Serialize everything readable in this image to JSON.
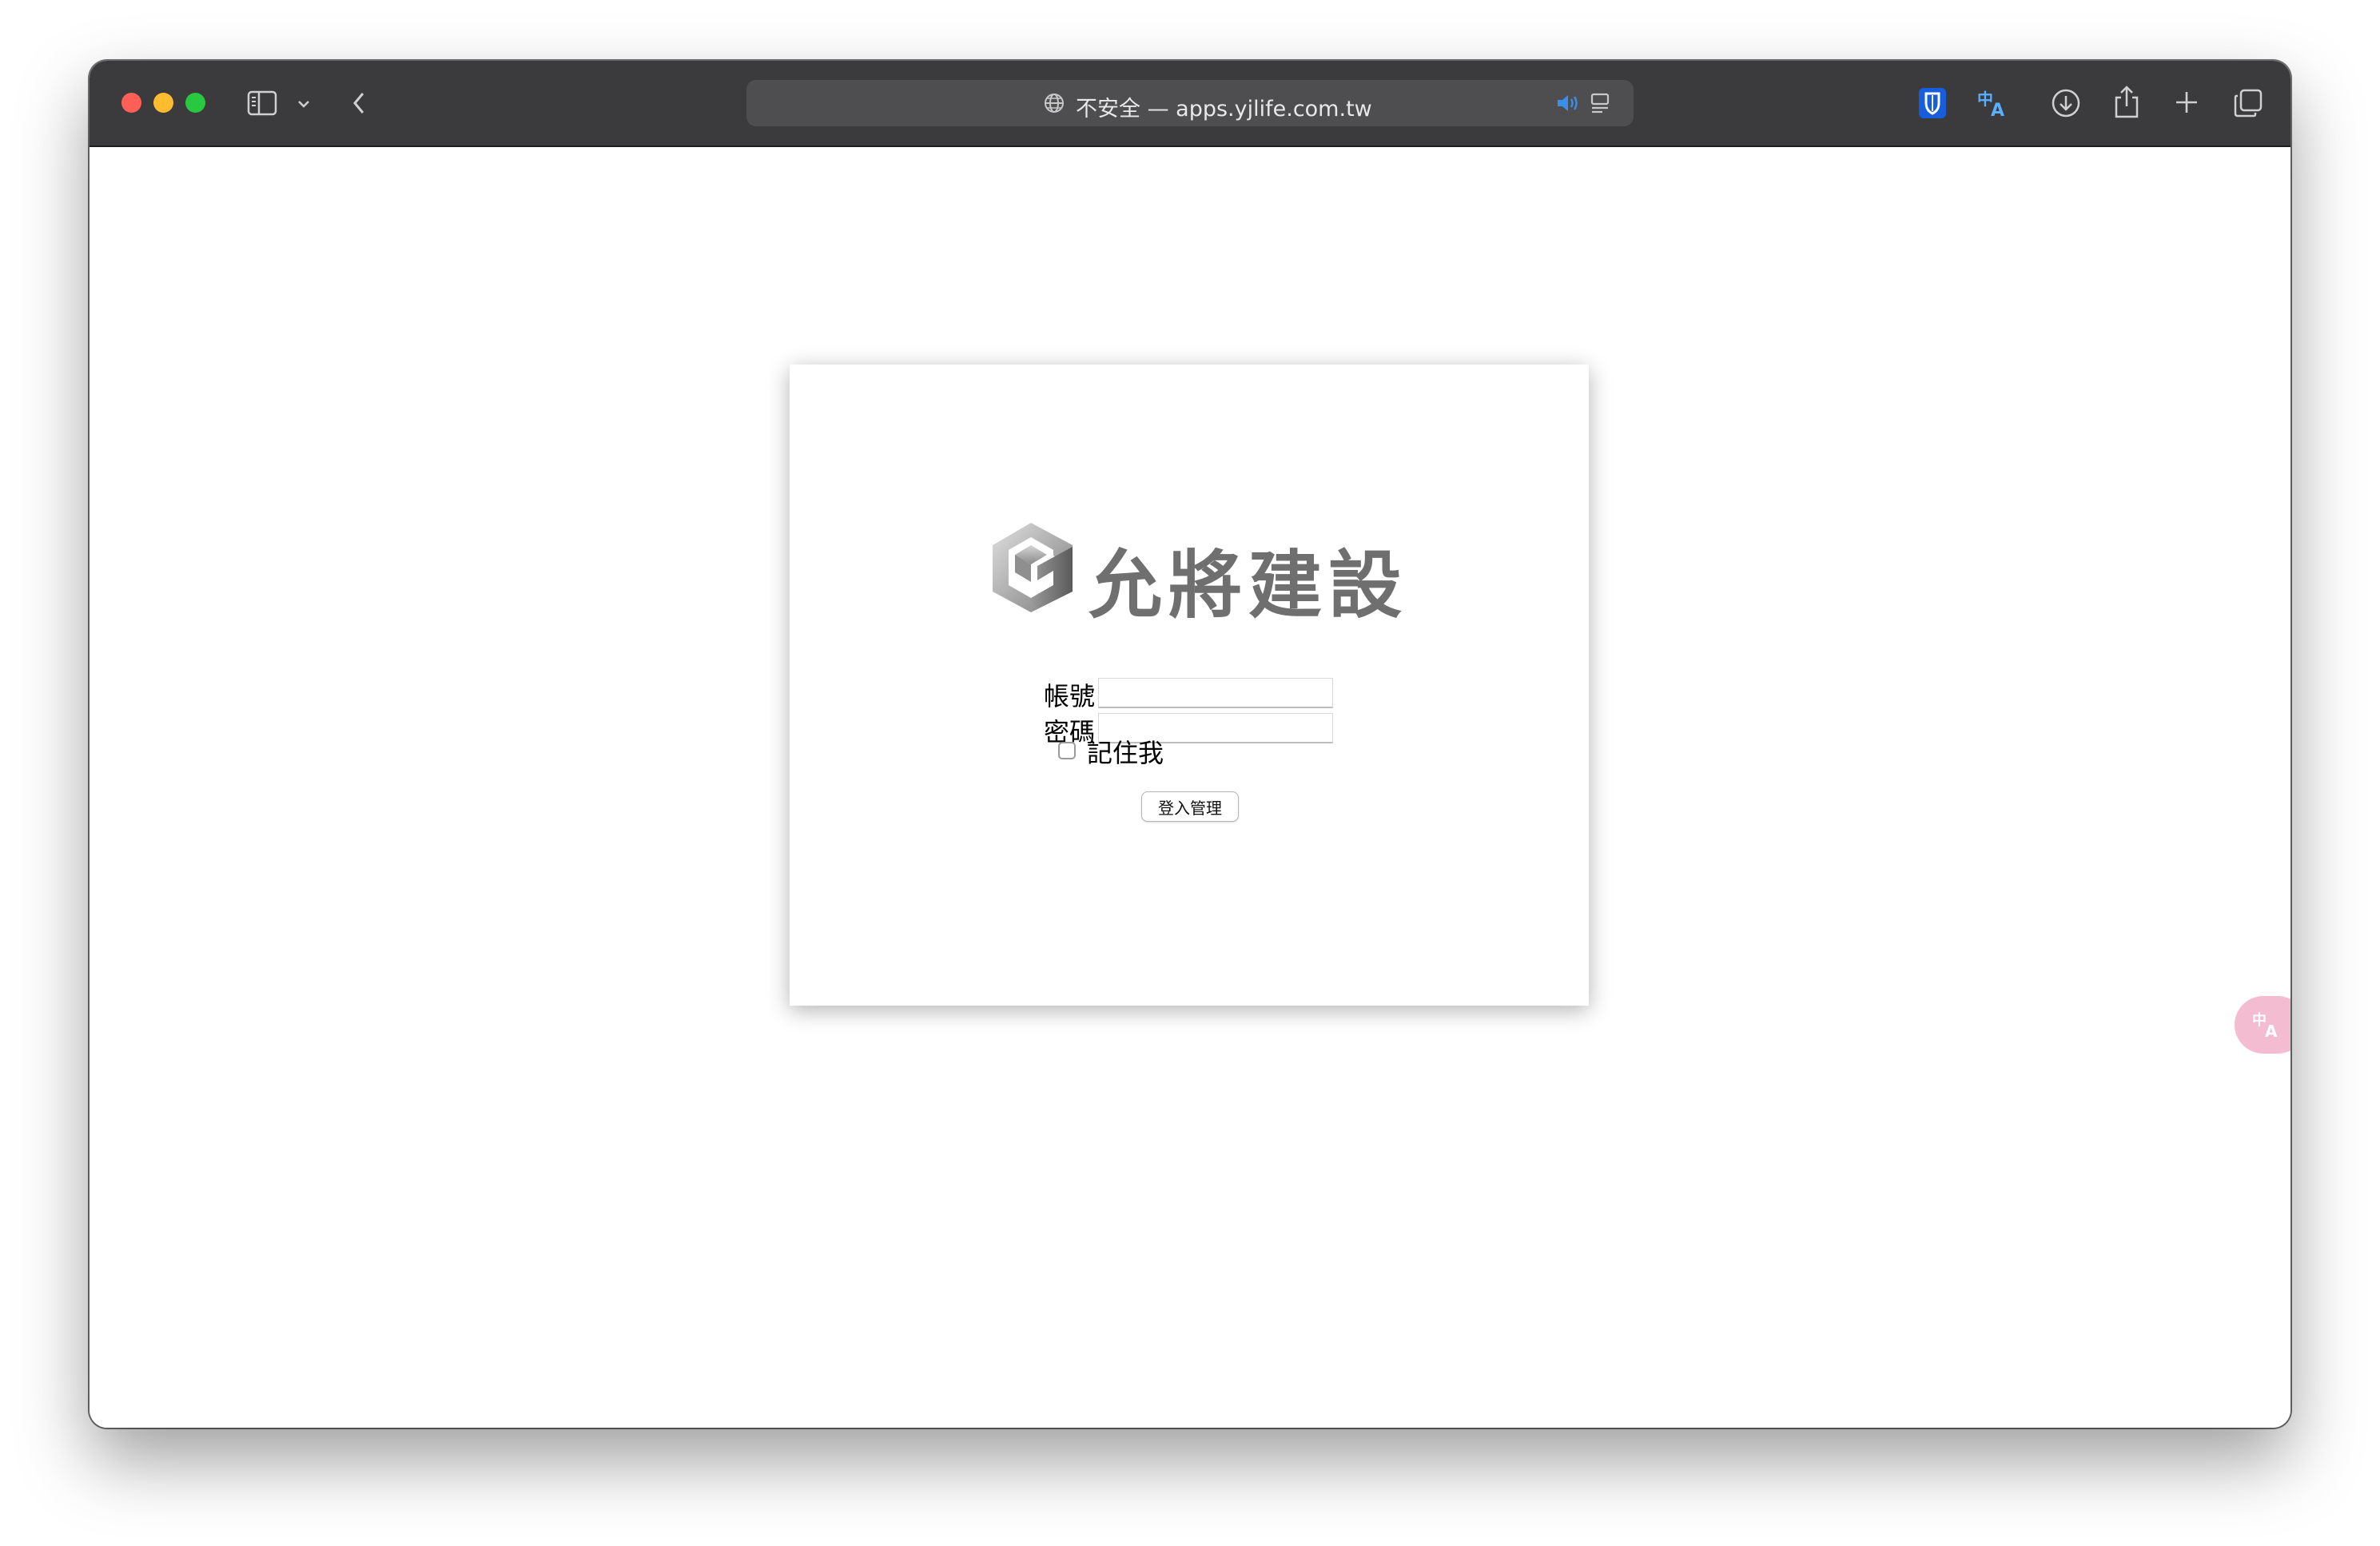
{
  "browser": {
    "address": "不安全 — apps.yjlife.com.tw",
    "icons": {
      "sidebar": "sidebar-icon",
      "chevron": "chevron-down-icon",
      "back": "back-arrow-icon",
      "globe": "globe-icon",
      "audio": "speaker-icon",
      "reader": "reader-icon",
      "bitwarden": "shield-icon",
      "translate": "translate-icon",
      "download": "download-icon",
      "share": "share-icon",
      "new_tab": "plus-icon",
      "tabs": "tab-overview-icon"
    },
    "colors": {
      "titlebar": "#3b3b3d",
      "close": "#ff5f57",
      "minimize": "#febc2e",
      "zoom": "#28c840",
      "audio_accent": "#3b8eea",
      "shield_accent": "#175ddc"
    }
  },
  "page": {
    "logo_text": "允將建設",
    "account_label": "帳號",
    "account_value": "",
    "password_label": "密碼",
    "password_value": "",
    "remember_label": "記住我",
    "remember_checked": false,
    "login_button": "登入管理",
    "translate_fab_icon": "translate-icon",
    "colors": {
      "logo_gray": "#6f6f6f",
      "fab_pink": "#f3bcd0"
    }
  }
}
